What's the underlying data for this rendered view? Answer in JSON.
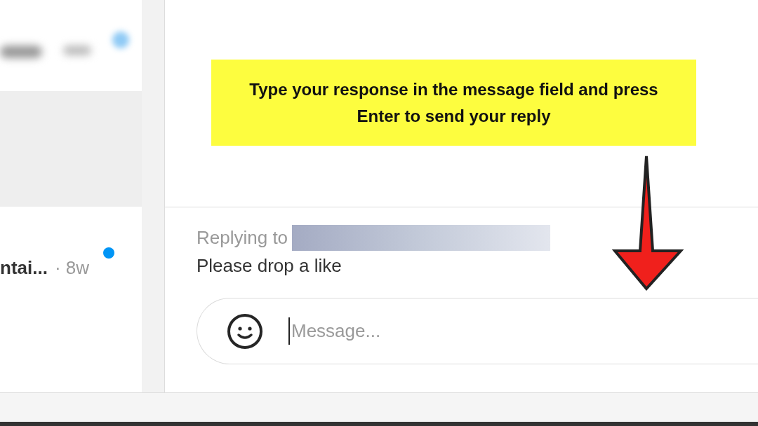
{
  "conversations": [
    {
      "preview": "ntai...",
      "time": "· 8w",
      "unread": true
    }
  ],
  "reply": {
    "label": "Replying to",
    "quoted_message": "Please drop a like"
  },
  "composer": {
    "placeholder": "Message..."
  },
  "callout": {
    "text": "Type your response in the message field and press Enter to send your reply"
  }
}
